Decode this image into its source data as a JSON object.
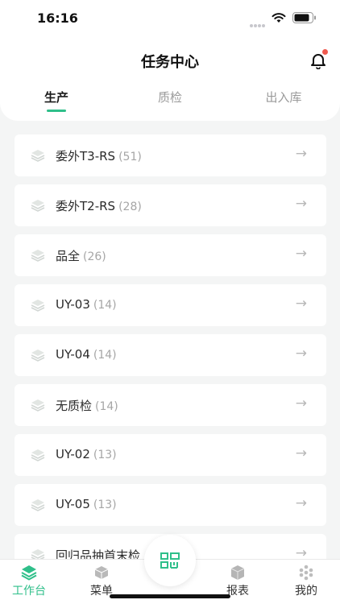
{
  "status_bar": {
    "time": "16:16"
  },
  "header": {
    "title": "任务中心"
  },
  "tabs": [
    {
      "label": "生产",
      "active": true
    },
    {
      "label": "质检",
      "active": false
    },
    {
      "label": "出入库",
      "active": false
    }
  ],
  "tasks": [
    {
      "name": "委外T3-RS",
      "count": "(51)"
    },
    {
      "name": "委外T2-RS",
      "count": "(28)"
    },
    {
      "name": "品全",
      "count": "(26)"
    },
    {
      "name": "UY-03",
      "count": "(14)"
    },
    {
      "name": "UY-04",
      "count": "(14)"
    },
    {
      "name": "无质检",
      "count": "(14)"
    },
    {
      "name": "UY-02",
      "count": "(13)"
    },
    {
      "name": "UY-05",
      "count": "(13)"
    },
    {
      "name": "回归品抽首末检",
      "count": ""
    }
  ],
  "bottom_nav": [
    {
      "label": "工作台",
      "icon": "layers-icon",
      "active": true
    },
    {
      "label": "菜单",
      "icon": "box-icon",
      "active": false
    },
    {
      "label": "报表",
      "icon": "cube-icon",
      "active": false
    },
    {
      "label": "我的",
      "icon": "dots-icon",
      "active": false
    }
  ],
  "colors": {
    "accent": "#2fbf8a",
    "notification": "#f05a4f",
    "background": "#f4f5f5"
  }
}
